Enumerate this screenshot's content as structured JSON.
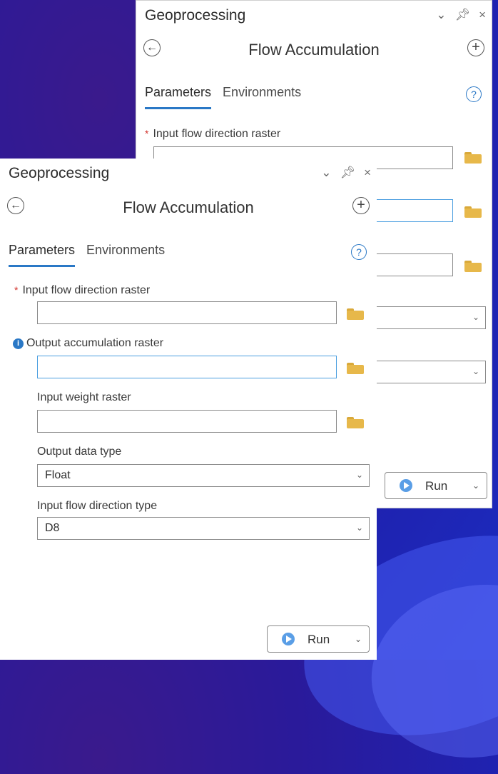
{
  "back_window": {
    "title": "Geoprocessing",
    "controls": {
      "collapse": "⌄",
      "pin": "⊕",
      "close": "×"
    },
    "tool_title": "Flow Accumulation",
    "tabs": [
      {
        "label": "Parameters"
      },
      {
        "label": "Environments"
      }
    ],
    "help": "?",
    "param_label": "Input flow direction raster",
    "run_label": "Run"
  },
  "front_window": {
    "title": "Geoprocessing",
    "controls": {
      "collapse": "⌄",
      "pin": "⊕",
      "close": "×"
    },
    "tool_title": "Flow Accumulation",
    "tabs": [
      {
        "label": "Parameters"
      },
      {
        "label": "Environments"
      }
    ],
    "help": "?",
    "params": [
      {
        "label": "Input flow direction raster",
        "value": "",
        "required": true
      },
      {
        "label": "Output accumulation raster",
        "value": "",
        "info": true
      },
      {
        "label": "Input weight raster",
        "value": ""
      }
    ],
    "output_data_type": {
      "label": "Output data type",
      "value": "Float"
    },
    "flow_dir_type": {
      "label": "Input flow direction type",
      "value": "D8"
    },
    "run_label": "Run"
  },
  "icons": {
    "back": "⊖",
    "add": "+",
    "required": "*",
    "info": "i",
    "dropdown": "⌄"
  },
  "colors": {
    "accent": "#2a78c6",
    "required": "#d2342e",
    "folder": "#e7b84a",
    "run_play": "#5a9ee6"
  }
}
